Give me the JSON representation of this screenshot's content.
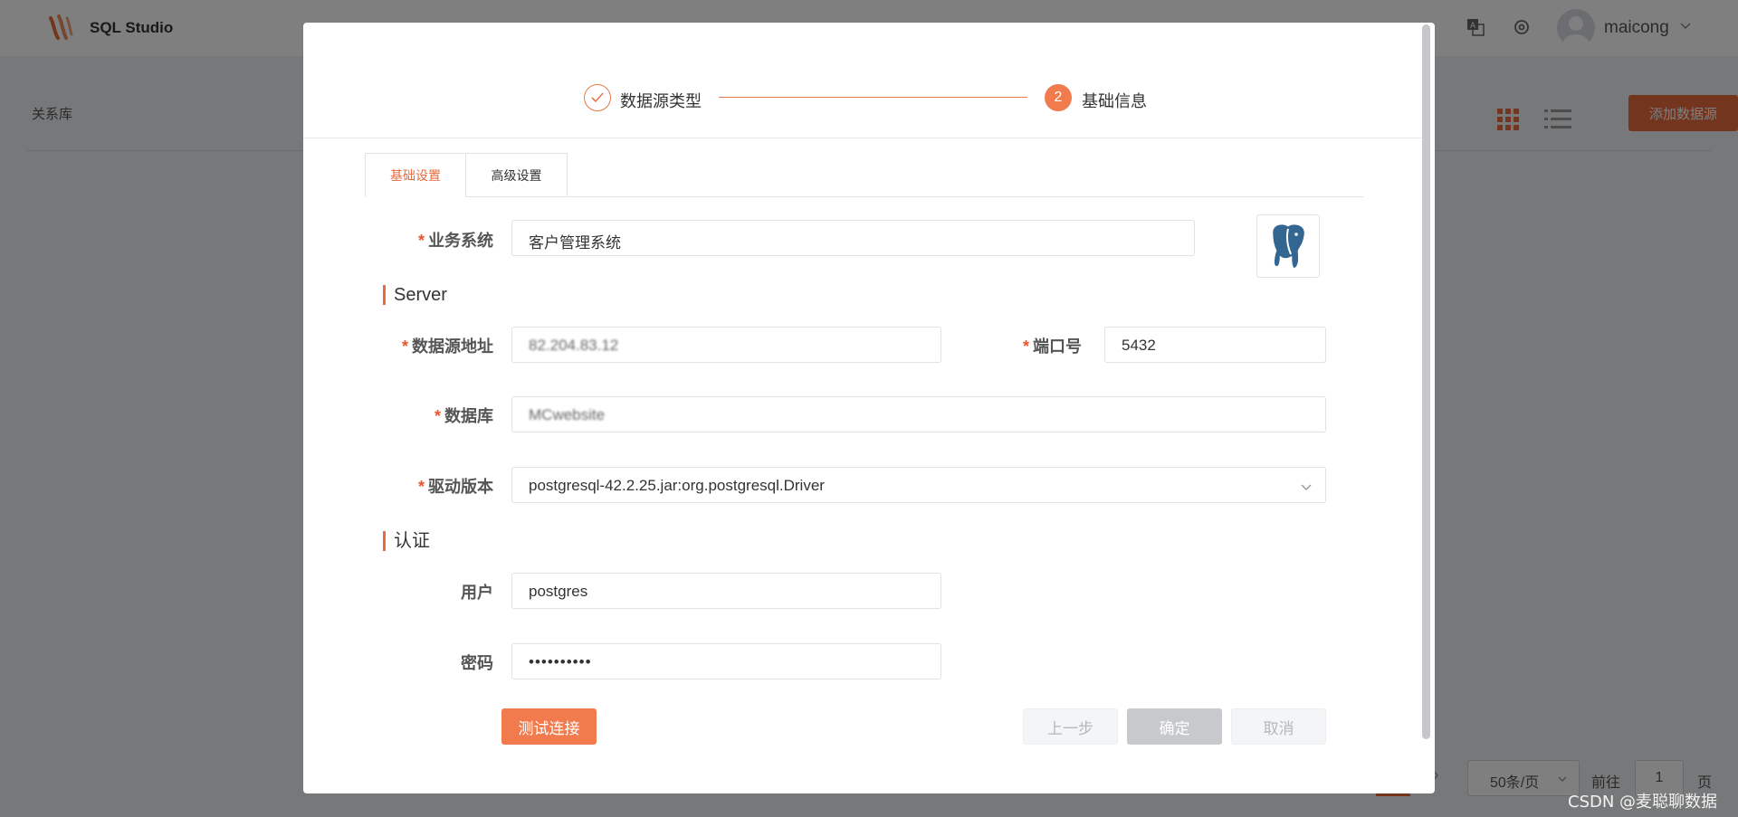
{
  "app": {
    "title": "SQL Studio",
    "username": "maicong"
  },
  "page": {
    "breadcrumb": "关系库",
    "add_button": "添加数据源"
  },
  "pagination": {
    "page_size": "50条/页",
    "goto_label": "前往",
    "current_page": "1",
    "page_suffix": "页"
  },
  "watermark": "CSDN @麦聪聊数据",
  "colors": {
    "accent": "#e86a3d",
    "step_active": "#f27b4d",
    "required": "#e8552f"
  },
  "icons": {
    "logo": "studio-logo-icon",
    "translate": "translate-icon",
    "settings": "gear-icon",
    "avatar": "avatar-icon",
    "grid_view": "grid-view-icon",
    "list_view": "list-view-icon",
    "step_done": "check-icon",
    "db_logo": "postgresql-elephant-icon",
    "dropdown": "chevron-down-icon"
  },
  "modal": {
    "steps": [
      {
        "label": "数据源类型",
        "status": "done"
      },
      {
        "number": "2",
        "label": "基础信息",
        "status": "active"
      }
    ],
    "tabs": [
      {
        "label": "基础设置",
        "active": true
      },
      {
        "label": "高级设置",
        "active": false
      }
    ],
    "fields": {
      "business_system": {
        "label": "业务系统",
        "value": "客户管理系统",
        "required": true
      },
      "host": {
        "label": "数据源地址",
        "value": "82.204.83.12",
        "required": true,
        "obscured": true
      },
      "port": {
        "label": "端口号",
        "value": "5432",
        "required": true
      },
      "database": {
        "label": "数据库",
        "value": "MCwebsite",
        "required": true,
        "obscured": true
      },
      "driver": {
        "label": "驱动版本",
        "value": "postgresql-42.2.25.jar:org.postgresql.Driver",
        "required": true
      },
      "user": {
        "label": "用户",
        "value": "postgres",
        "required": false
      },
      "password": {
        "label": "密码",
        "value": "••••••••••",
        "required": false
      }
    },
    "sections": {
      "server": "Server",
      "auth": "认证"
    },
    "buttons": {
      "test": "测试连接",
      "prev": "上一步",
      "ok": "确定",
      "cancel": "取消"
    }
  }
}
